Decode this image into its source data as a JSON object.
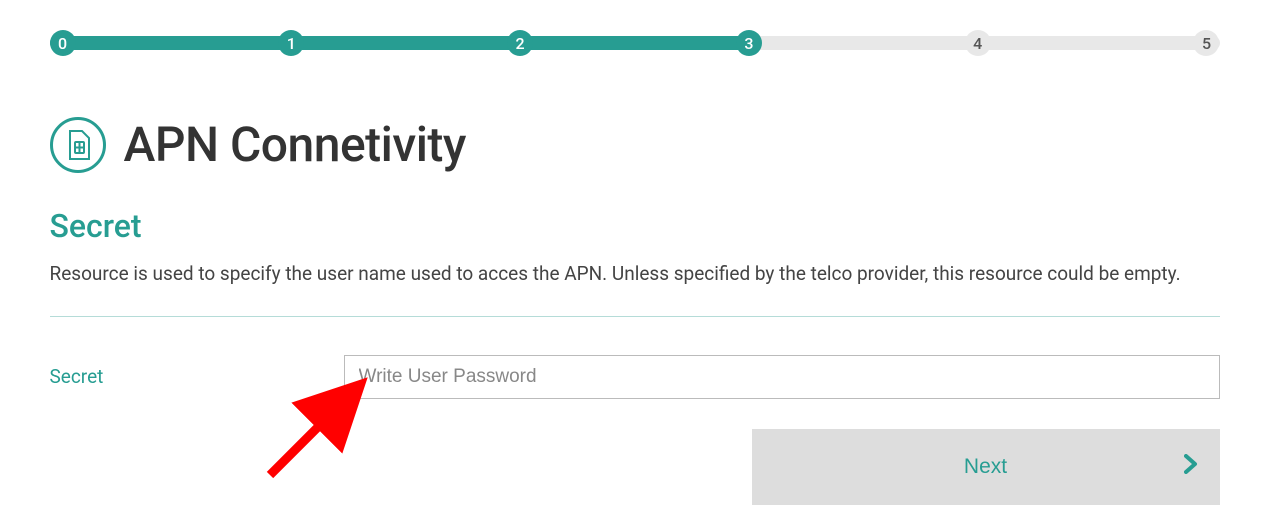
{
  "stepper": {
    "steps": [
      "0",
      "1",
      "2",
      "3",
      "4",
      "5"
    ],
    "current": 3,
    "fill_percent": 60
  },
  "title": "APN Connetivity",
  "section": {
    "heading": "Secret",
    "description": "Resource is used to specify the user name used to acces the APN. Unless specified by the telco provider, this resource could be empty."
  },
  "form": {
    "label": "Secret",
    "placeholder": "Write User Password",
    "value": ""
  },
  "next_label": "Next"
}
